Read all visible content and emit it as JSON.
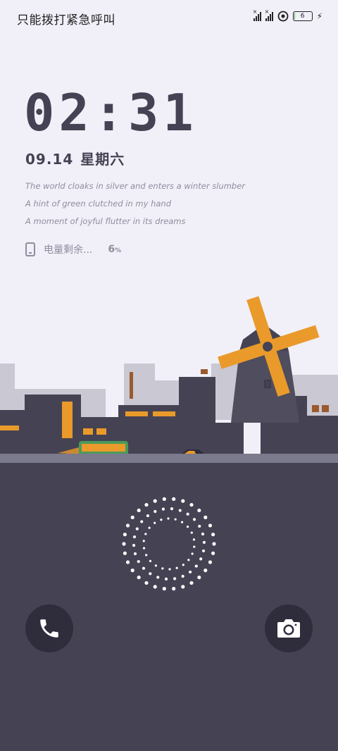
{
  "status_bar": {
    "carrier_text": "只能拨打紧急呼叫",
    "battery_level": "6",
    "battery_fraction": 0.06
  },
  "lockscreen": {
    "time": "02:31",
    "date": "09.14",
    "weekday": "星期六",
    "poem_lines": [
      "The world cloaks in silver and enters a winter slumber",
      "A hint of green clutched in my hand",
      "A moment of joyful flutter in its dreams"
    ],
    "battery_label": "电量剩余...",
    "battery_value": "6",
    "battery_unit": "%"
  },
  "colors": {
    "background": "#f1f0f8",
    "dark": "#454353",
    "accent": "#ea9a2a",
    "bus_green": "#4a9a5c"
  },
  "shortcuts": {
    "left_icon": "phone-icon",
    "right_icon": "camera-icon"
  }
}
